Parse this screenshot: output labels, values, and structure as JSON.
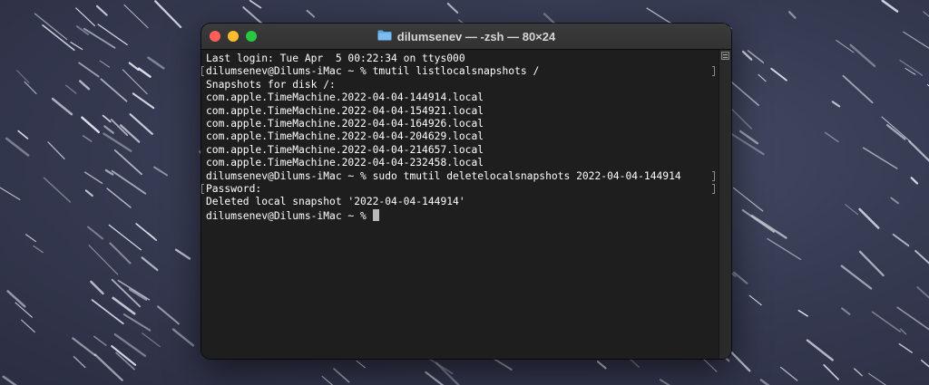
{
  "window": {
    "title": "dilumsenev — -zsh — 80×24",
    "title_icon": "folder-icon"
  },
  "terminal": {
    "lines": {
      "l0": "Last login: Tue Apr  5 00:22:34 on ttys000",
      "l1": "dilumsenev@Dilums-iMac ~ % tmutil listlocalsnapshots /",
      "l2": "Snapshots for disk /:",
      "l3": "com.apple.TimeMachine.2022-04-04-144914.local",
      "l4": "com.apple.TimeMachine.2022-04-04-154921.local",
      "l5": "com.apple.TimeMachine.2022-04-04-164926.local",
      "l6": "com.apple.TimeMachine.2022-04-04-204629.local",
      "l7": "com.apple.TimeMachine.2022-04-04-214657.local",
      "l8": "com.apple.TimeMachine.2022-04-04-232458.local",
      "l9": "dilumsenev@Dilums-iMac ~ % sudo tmutil deletelocalsnapshots 2022-04-04-144914",
      "l10": "Password:",
      "l11": "Deleted local snapshot '2022-04-04-144914'",
      "l12": "dilumsenev@Dilums-iMac ~ % "
    }
  },
  "colors": {
    "terminal_bg": "#1e1e1e",
    "terminal_text": "#ffffff",
    "close": "#ff5f57",
    "minimize": "#febc2e",
    "maximize": "#28c840",
    "folder": "#5aa7e6"
  }
}
